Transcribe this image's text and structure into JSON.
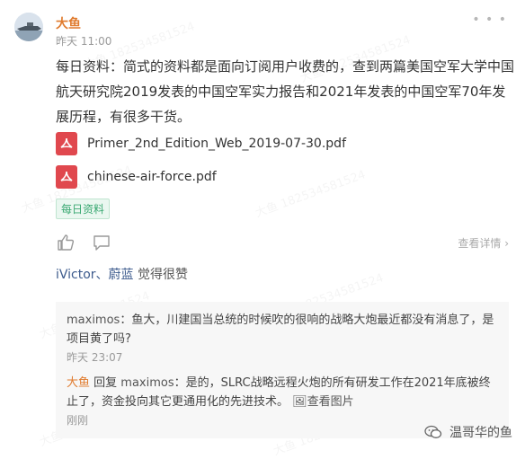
{
  "post": {
    "author": "大鱼",
    "time": "昨天 11:00",
    "text": "每日资料：简式的资料都是面向订阅用户收费的，查到两篇美国空军大学中国航天研究院2019发表的中国空军实力报告和2021年发表的中国空军70年发展历程，有很多干货。",
    "attachments": [
      {
        "name": "Primer_2nd_Edition_Web_2019-07-30.pdf",
        "icon": "pdf-icon"
      },
      {
        "name": "chinese-air-force.pdf",
        "icon": "pdf-icon"
      }
    ],
    "tag": "每日资料",
    "detail_link": "查看详情",
    "more_icon": "more-dots-icon"
  },
  "likes": {
    "names": "iVictor、蔚蓝",
    "suffix": " 觉得很赞"
  },
  "comments": [
    {
      "user": "maximos",
      "separator": "：",
      "text": "鱼大，川建国当总统的时候吹的很响的战略大炮最近都没有消息了，是项目黄了吗?",
      "time": "昨天 23:07"
    },
    {
      "user": "大鱼",
      "reply_word": " 回复 ",
      "reply_to": "maximos",
      "separator": "：",
      "text": "是的，SLRC战略远程火炮的所有研发工作在2021年底被终止了，资金投向其它更通用化的先进技术。",
      "view_image": "查看图片",
      "time": "刚刚"
    }
  ],
  "brand": {
    "name": "温哥华的鱼",
    "icon": "wechat-icon"
  },
  "colors": {
    "author": "#e07b2e",
    "tag_green": "#3aa872",
    "pdf_red": "#e0484e",
    "likes_blue": "#3d5b8d"
  },
  "watermark_text": "大鱼 182534581524"
}
